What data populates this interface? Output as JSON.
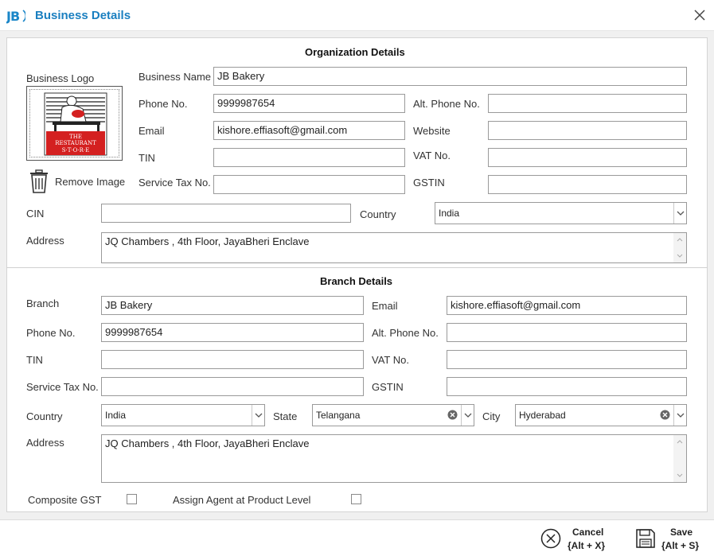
{
  "window": {
    "title": "Business Details",
    "app_icon": "jb-logo-icon",
    "close_icon": "close-icon"
  },
  "org": {
    "heading": "Organization Details",
    "logo_label": "Business Logo",
    "logo_image": {
      "line1": "THE",
      "line2": "RESTAURANT",
      "line3": "S·T·O·R·E"
    },
    "remove_image_label": "Remove Image",
    "business_name_label": "Business Name",
    "business_name_value": "JB Bakery",
    "phone_label": "Phone No.",
    "phone_value": "9999987654",
    "alt_phone_label": "Alt. Phone No.",
    "alt_phone_value": "",
    "email_label": "Email",
    "email_value": "kishore.effiasoft@gmail.com",
    "website_label": "Website",
    "website_value": "",
    "tin_label": "TIN",
    "tin_value": "",
    "vat_label": "VAT No.",
    "vat_value": "",
    "service_tax_label": "Service Tax No.",
    "service_tax_value": "",
    "gstin_label": "GSTIN",
    "gstin_value": "",
    "cin_label": "CIN",
    "cin_value": "",
    "country_label": "Country",
    "country_value": "India",
    "address_label": "Address",
    "address_value": "JQ Chambers , 4th Floor, JayaBheri Enclave"
  },
  "branch": {
    "heading": "Branch Details",
    "branch_label": "Branch",
    "branch_value": "JB Bakery",
    "email_label": "Email",
    "email_value": "kishore.effiasoft@gmail.com",
    "phone_label": "Phone No.",
    "phone_value": "9999987654",
    "alt_phone_label": "Alt. Phone No.",
    "alt_phone_value": "",
    "tin_label": "TIN",
    "tin_value": "",
    "vat_label": "VAT No.",
    "vat_value": "",
    "service_tax_label": "Service Tax No.",
    "service_tax_value": "",
    "gstin_label": "GSTIN",
    "gstin_value": "",
    "country_label": "Country",
    "country_value": "India",
    "state_label": "State",
    "state_value": "Telangana",
    "city_label": "City",
    "city_value": "Hyderabad",
    "address_label": "Address",
    "address_value": "JQ Chambers , 4th Floor, JayaBheri Enclave",
    "composite_gst_label": "Composite GST",
    "composite_gst_checked": false,
    "assign_agent_label": "Assign Agent at Product Level",
    "assign_agent_checked": false
  },
  "footer": {
    "cancel_label": "Cancel",
    "cancel_shortcut": "{Alt + X}",
    "save_label": "Save",
    "save_shortcut": "{Alt + S}"
  },
  "colors": {
    "title": "#1a7fc0",
    "logo_red": "#d42020",
    "border": "#9a9a9a"
  }
}
